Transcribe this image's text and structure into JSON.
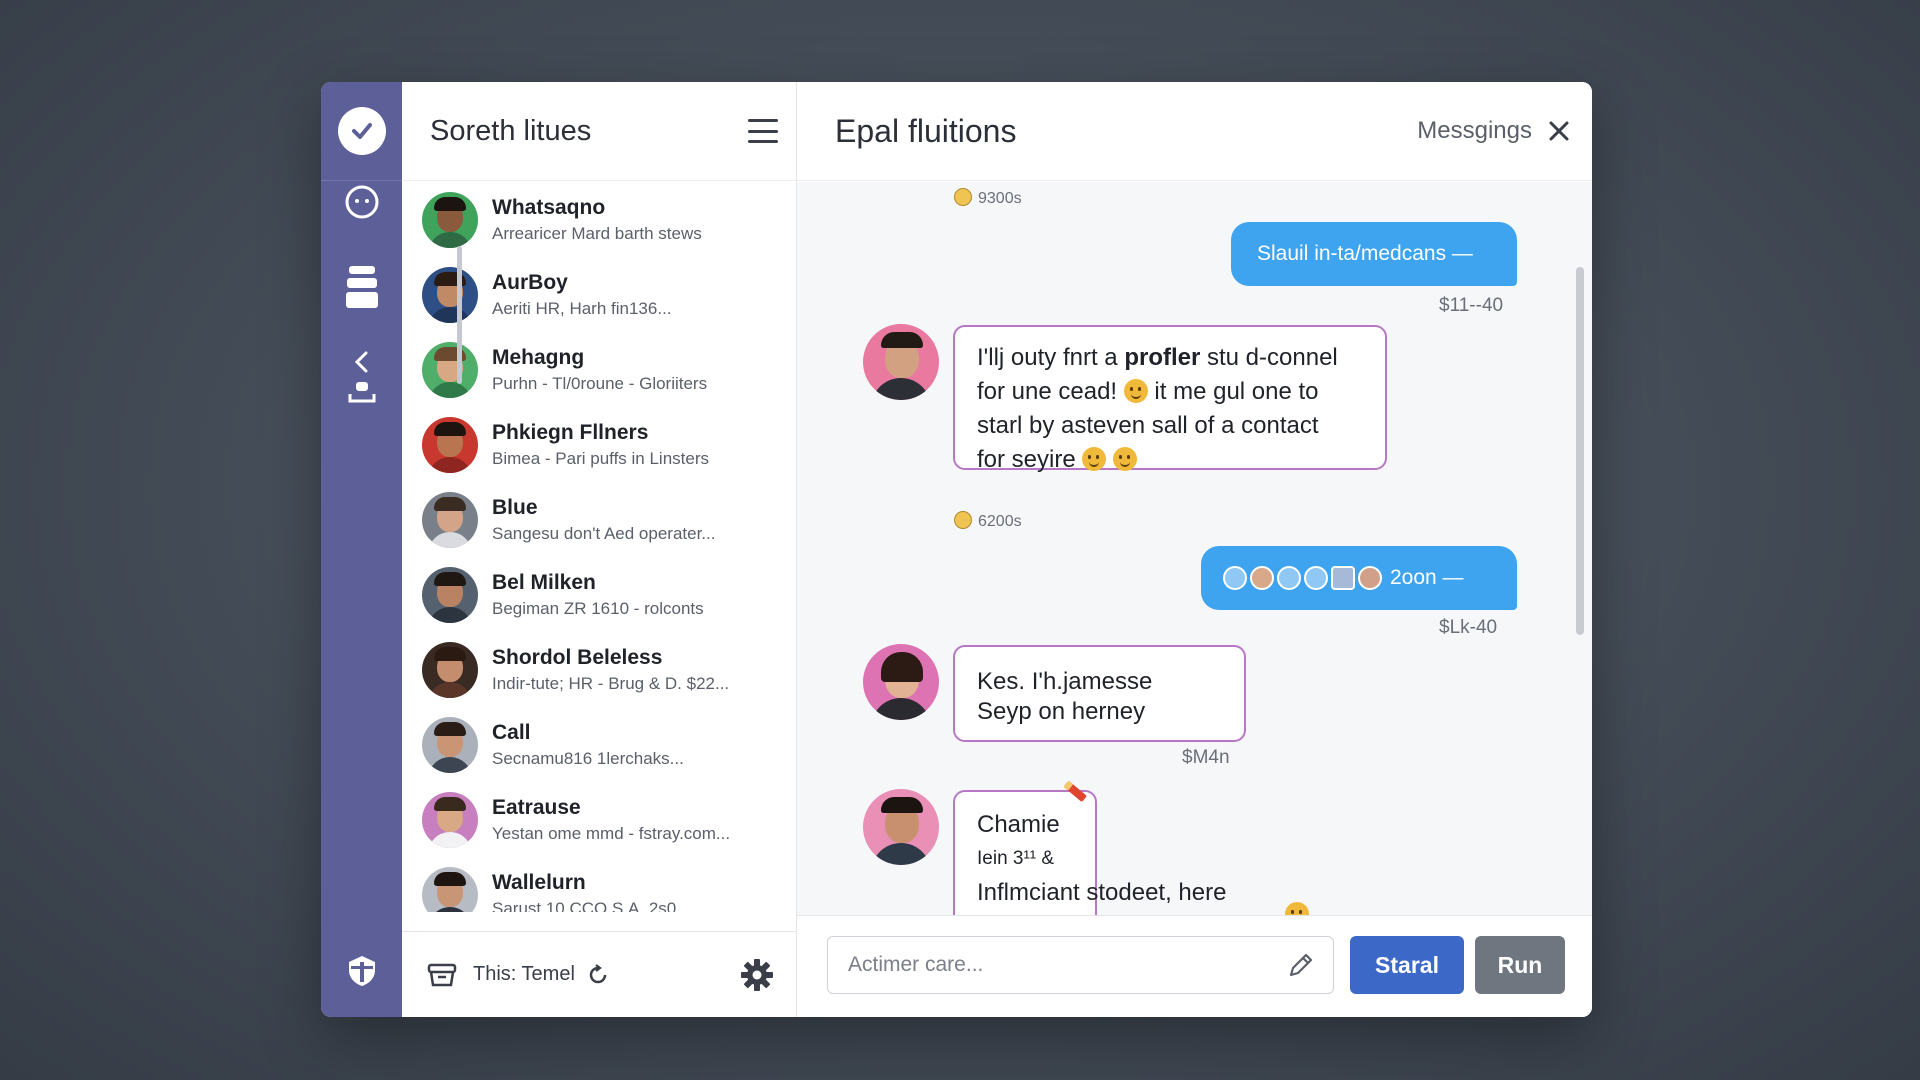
{
  "sidebar_rail": {
    "icons": [
      "check-icon",
      "chat-bubble-icon",
      "archive-stack-icon",
      "back-icon",
      "inbox-icon",
      "shield-icon"
    ]
  },
  "contacts_panel": {
    "title": "Soreth litues",
    "items": [
      {
        "name": "Whatsaqno",
        "sub": "Arrearicer Mard barth stews",
        "avatar_bg": "#3fa35c",
        "skin": "#8a5a3c",
        "hair": "#1b1410",
        "shirt": "#2e6b45"
      },
      {
        "name": "AurBoy",
        "sub": "Aeriti HR, Harh fin136...",
        "avatar_bg": "#2d4f86",
        "skin": "#c08a67",
        "hair": "#2a1c14",
        "shirt": "#1f3559"
      },
      {
        "name": "Mehagng",
        "sub": "Purhn - Tl/0roune - Gloriiters",
        "avatar_bg": "#4fae6a",
        "skin": "#d7a883",
        "hair": "#6b4a2f",
        "shirt": "#2f7a48"
      },
      {
        "name": "Phkiegn Fllners",
        "sub": "Bimea - Pari puffs in Linsters",
        "avatar_bg": "#c8382f",
        "skin": "#b9754f",
        "hair": "#1d1410",
        "shirt": "#8f2520"
      },
      {
        "name": "Blue",
        "sub": "Sangesu don't Aed operater...",
        "avatar_bg": "#7a8089",
        "skin": "#d3a488",
        "hair": "#3a2c22",
        "shirt": "#d9dbe0"
      },
      {
        "name": "Bel Milken",
        "sub": "Begiman ZR 1610 - rolconts",
        "avatar_bg": "#566170",
        "skin": "#b98363",
        "hair": "#1f1712",
        "shirt": "#2c3440"
      },
      {
        "name": "Shordol Beleless",
        "sub": "Indir-tute; HR - Brug & D. $22...",
        "avatar_bg": "#3a2a24",
        "skin": "#c48e6e",
        "hair": "#2b1a12",
        "shirt": "#5a3628"
      },
      {
        "name": "Call",
        "sub": "Secnamu816 1lerchaks...",
        "avatar_bg": "#aab1bb",
        "skin": "#c99574",
        "hair": "#2a1d15",
        "shirt": "#3d4552"
      },
      {
        "name": "Eatrause",
        "sub": "Yestan ome mmd - fstray.com...",
        "avatar_bg": "#c77fbf",
        "skin": "#d9a885",
        "hair": "#3a2a1e",
        "shirt": "#f2f2f4"
      },
      {
        "name": "Wallelurn",
        "sub": "Sarust 10 CCO S.A, 2s0...",
        "avatar_bg": "#b7bcc4",
        "skin": "#c89576",
        "hair": "#1e1511",
        "shirt": "#2c323b"
      }
    ],
    "footer_label": "This: Temel"
  },
  "chat": {
    "title": "Epal fluitions",
    "header_label": "Messgings",
    "messages": {
      "ts1": "9300s",
      "out1": "Slauil in-ta/medcans —",
      "out1_time": "$11--40",
      "in1_a": "I'llj outy fnrt a ",
      "in1_bold": "profler",
      "in1_b": " stu d-connel",
      "in1_c": "for une cead! ",
      "in1_d": " it me gul one to",
      "in1_e": "starl by asteven sall of a contact",
      "in1_f": "for seyire ",
      "ts2": "6200s",
      "out2": "2oon —",
      "out2_time": "$Lk-40",
      "in2_line1": "Kes. I'h.jamesse",
      "in2_line2": "Seyp on herney",
      "in2_time": "$M4n",
      "in3_name": "Chamie",
      "in3_line1": "Iein 3¹¹ &",
      "in3_line2": "Inflmciant stodeet, here"
    },
    "composer": {
      "placeholder": "Actimer care...",
      "primary_button": "Staral",
      "secondary_button": "Run"
    }
  },
  "colors": {
    "rail": "#5d5f98",
    "outgoing_bubble": "#3ea4f0",
    "incoming_border": "#b777c6",
    "primary_button": "#3c68c8",
    "secondary_button": "#6f7680"
  }
}
